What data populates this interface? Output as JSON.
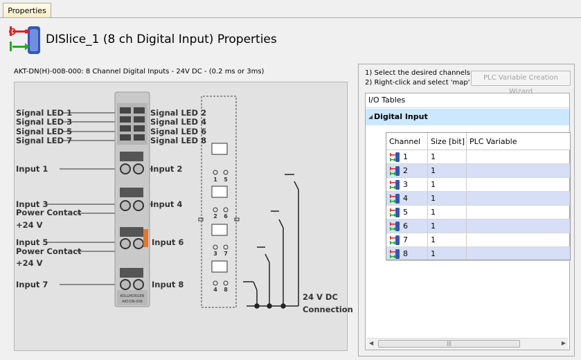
{
  "tab": {
    "label": "Properties"
  },
  "header": {
    "title": "DISlice_1 (8 ch Digital Input) Properties"
  },
  "module": {
    "description": "AKT-DN(H)-008-000: 8 Channel Digital Inputs - 24V DC - (0.2 ms or 3ms)",
    "labels_left": [
      "Signal LED 1",
      "Signal LED 3",
      "Signal LED 5",
      "Signal LED 7",
      "Input 1",
      "Input 3",
      "Power Contact",
      "+24 V",
      "Input 5",
      "Power Contact",
      "+24 V",
      "Input 7"
    ],
    "labels_right": [
      "Signal LED 2",
      "Signal LED 4",
      "Signal LED 6",
      "Signal LED 8",
      "Input 2",
      "Input 4",
      "Input 6",
      "Input 8"
    ],
    "brand": "KOLLMORGEN",
    "part": "AKT-DN-008",
    "terminal_numbers": [
      "1",
      "5",
      "2",
      "6",
      "3",
      "7",
      "4",
      "8"
    ],
    "connection_label_1": "24 V DC",
    "connection_label_2": "Connection"
  },
  "instructions": {
    "line1": "1) Select the desired channels",
    "line2": "2) Right-click and select 'map'"
  },
  "wizard_button": {
    "label": "PLC Variable Creation Wizard"
  },
  "io_tables": {
    "header": "I/O Tables",
    "group": "Digital Input",
    "columns": [
      "Channel",
      "Size [bit]",
      "PLC Variable"
    ],
    "rows": [
      {
        "channel": "1",
        "size": "1",
        "variable": ""
      },
      {
        "channel": "2",
        "size": "1",
        "variable": ""
      },
      {
        "channel": "3",
        "size": "1",
        "variable": ""
      },
      {
        "channel": "4",
        "size": "1",
        "variable": ""
      },
      {
        "channel": "5",
        "size": "1",
        "variable": ""
      },
      {
        "channel": "6",
        "size": "1",
        "variable": ""
      },
      {
        "channel": "7",
        "size": "1",
        "variable": ""
      },
      {
        "channel": "8",
        "size": "1",
        "variable": ""
      }
    ]
  },
  "icons": {
    "header": "digital-io-module-icon",
    "channel": "digital-input-channel-icon"
  },
  "colors": {
    "selection": "#cce8ff",
    "alt_row": "#d6dff5",
    "accent_orange": "#e8752c",
    "module_blue": "#3355bb"
  }
}
